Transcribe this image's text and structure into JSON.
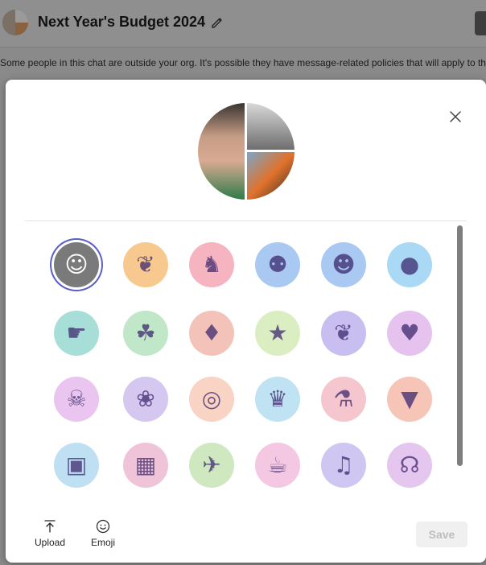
{
  "chat": {
    "title": "Next Year's Budget 2024",
    "notice": "Some people in this chat are outside your org. It's possible they have message-related policies that will apply to th"
  },
  "dialog": {
    "footer": {
      "upload_label": "Upload",
      "emoji_label": "Emoji",
      "save_label": "Save"
    },
    "icons": [
      {
        "name": "people-group-icon",
        "glyph": "☺",
        "bg": "#7a7a7a"
      },
      {
        "name": "bug-icon",
        "glyph": "❦",
        "bg": "#f7c98f"
      },
      {
        "name": "unicorn-icon",
        "glyph": "♞",
        "bg": "#f6b3c0"
      },
      {
        "name": "dog-icon",
        "glyph": "⚉",
        "bg": "#a9c8f2"
      },
      {
        "name": "thinking-face-icon",
        "glyph": "☻",
        "bg": "#a9c8f2"
      },
      {
        "name": "earth-icon",
        "glyph": "●",
        "bg": "#a9d9f5"
      },
      {
        "name": "helping-hand-icon",
        "glyph": "☛",
        "bg": "#a8ded8"
      },
      {
        "name": "plant-in-hand-icon",
        "glyph": "☘",
        "bg": "#bfe7c8"
      },
      {
        "name": "flame-hands-icon",
        "glyph": "♦",
        "bg": "#f3c2b8"
      },
      {
        "name": "star-wand-icon",
        "glyph": "★",
        "bg": "#dbeec1"
      },
      {
        "name": "handshake-icon",
        "glyph": "❦",
        "bg": "#c8bff0"
      },
      {
        "name": "heart-hands-icon",
        "glyph": "♥",
        "bg": "#e6c2ef"
      },
      {
        "name": "monster-icon",
        "glyph": "☠",
        "bg": "#e9c5ef"
      },
      {
        "name": "octopus-icon",
        "glyph": "❀",
        "bg": "#d5c8f0"
      },
      {
        "name": "donut-icon",
        "glyph": "◎",
        "bg": "#f9d3c4"
      },
      {
        "name": "rabbit-hat-icon",
        "glyph": "♛",
        "bg": "#bfe3f3"
      },
      {
        "name": "potion-icon",
        "glyph": "⚗",
        "bg": "#f6c6cf"
      },
      {
        "name": "ice-cream-icon",
        "glyph": "▼",
        "bg": "#f7c4b8"
      },
      {
        "name": "camera-icon",
        "glyph": "▣",
        "bg": "#bfe0f3"
      },
      {
        "name": "calendar-icon",
        "glyph": "▦",
        "bg": "#efc4d8"
      },
      {
        "name": "rocket-icon",
        "glyph": "✈",
        "bg": "#cfe8c0"
      },
      {
        "name": "teacup-icon",
        "glyph": "☕",
        "bg": "#f4c8e3"
      },
      {
        "name": "bell-icon",
        "glyph": "♫",
        "bg": "#cfc6f2"
      },
      {
        "name": "boombox-icon",
        "glyph": "☊",
        "bg": "#e5c6ee"
      }
    ]
  }
}
